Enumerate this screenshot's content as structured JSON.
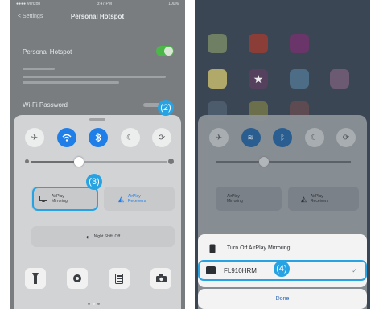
{
  "left": {
    "status": {
      "carrier": "●●●● Verizon",
      "time": "3:47 PM",
      "battery": "100%"
    },
    "nav": {
      "back": "< Settings",
      "title": "Personal Hotspot"
    },
    "hotspot_label": "Personal Hotspot",
    "wifi_password_label": "Wi-Fi Password",
    "callout_2": "(2)",
    "callout_3": "(3)",
    "airplay_label_1": "AirPlay",
    "airplay_label_2": "Mirroring",
    "audio_label_1": "AirPlay",
    "audio_label_2": "Receivers",
    "night_shift": "Night Shift: Off",
    "toggles": [
      "✈",
      "wifi",
      "bluetooth",
      "moon",
      "rotation-lock"
    ],
    "bottom": [
      "flashlight",
      "timer",
      "calculator",
      "camera"
    ]
  },
  "right": {
    "callout_4": "(4)",
    "airplay_label_1": "AirPlay",
    "airplay_label_2": "Mirroring",
    "audio_label_1": "AirPlay",
    "audio_label_2": "Receivers",
    "turn_off": "Turn Off AirPlay Mirroring",
    "device": "FL910HRM",
    "device_check": "✓",
    "done": "Done"
  },
  "colors": {
    "accent": "#27a3e3",
    "toggle_on": "#4cb749",
    "cc_active": "#1f7ee8"
  },
  "slider_level": 0.35
}
